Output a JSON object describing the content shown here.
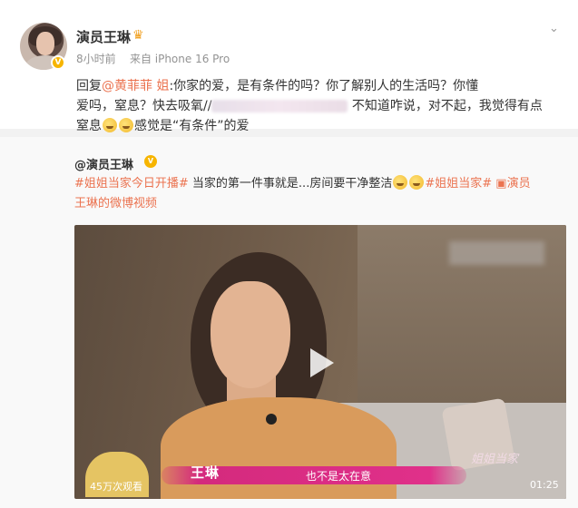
{
  "post": {
    "author": "演员王琳",
    "time": "8小时前",
    "source": "来自 iPhone 16 Pro",
    "reply_prefix": "回复",
    "mention_1": "@黄菲菲 姐",
    "reply_line_1": ":你家的爱，是有条件的吗？你了解别人的生活吗？你懂",
    "reply_line_2a": "爱吗，窒息？快去吸氧//",
    "reply_line_2b": "不知道咋说，对不起，我觉得有点",
    "reply_line_3a": "窒息",
    "reply_line_3b": "感觉是“有条件”的爱"
  },
  "repost": {
    "author": "@演员王琳",
    "tag_1": "#姐姐当家今日开播#",
    "text_1": " 当家的第一件事就是...房间要干净整洁",
    "tag_2": "#姐姐当家#",
    "video_link_icon": "video-camera-icon",
    "video_link": "演员",
    "video_link_2": "王琳的微博视频"
  },
  "video": {
    "subtitle_name": "王琳",
    "subtitle_line": "也不是太在意",
    "watermark": "姐姐当家",
    "views": "45万次观看",
    "duration": "01:25"
  }
}
